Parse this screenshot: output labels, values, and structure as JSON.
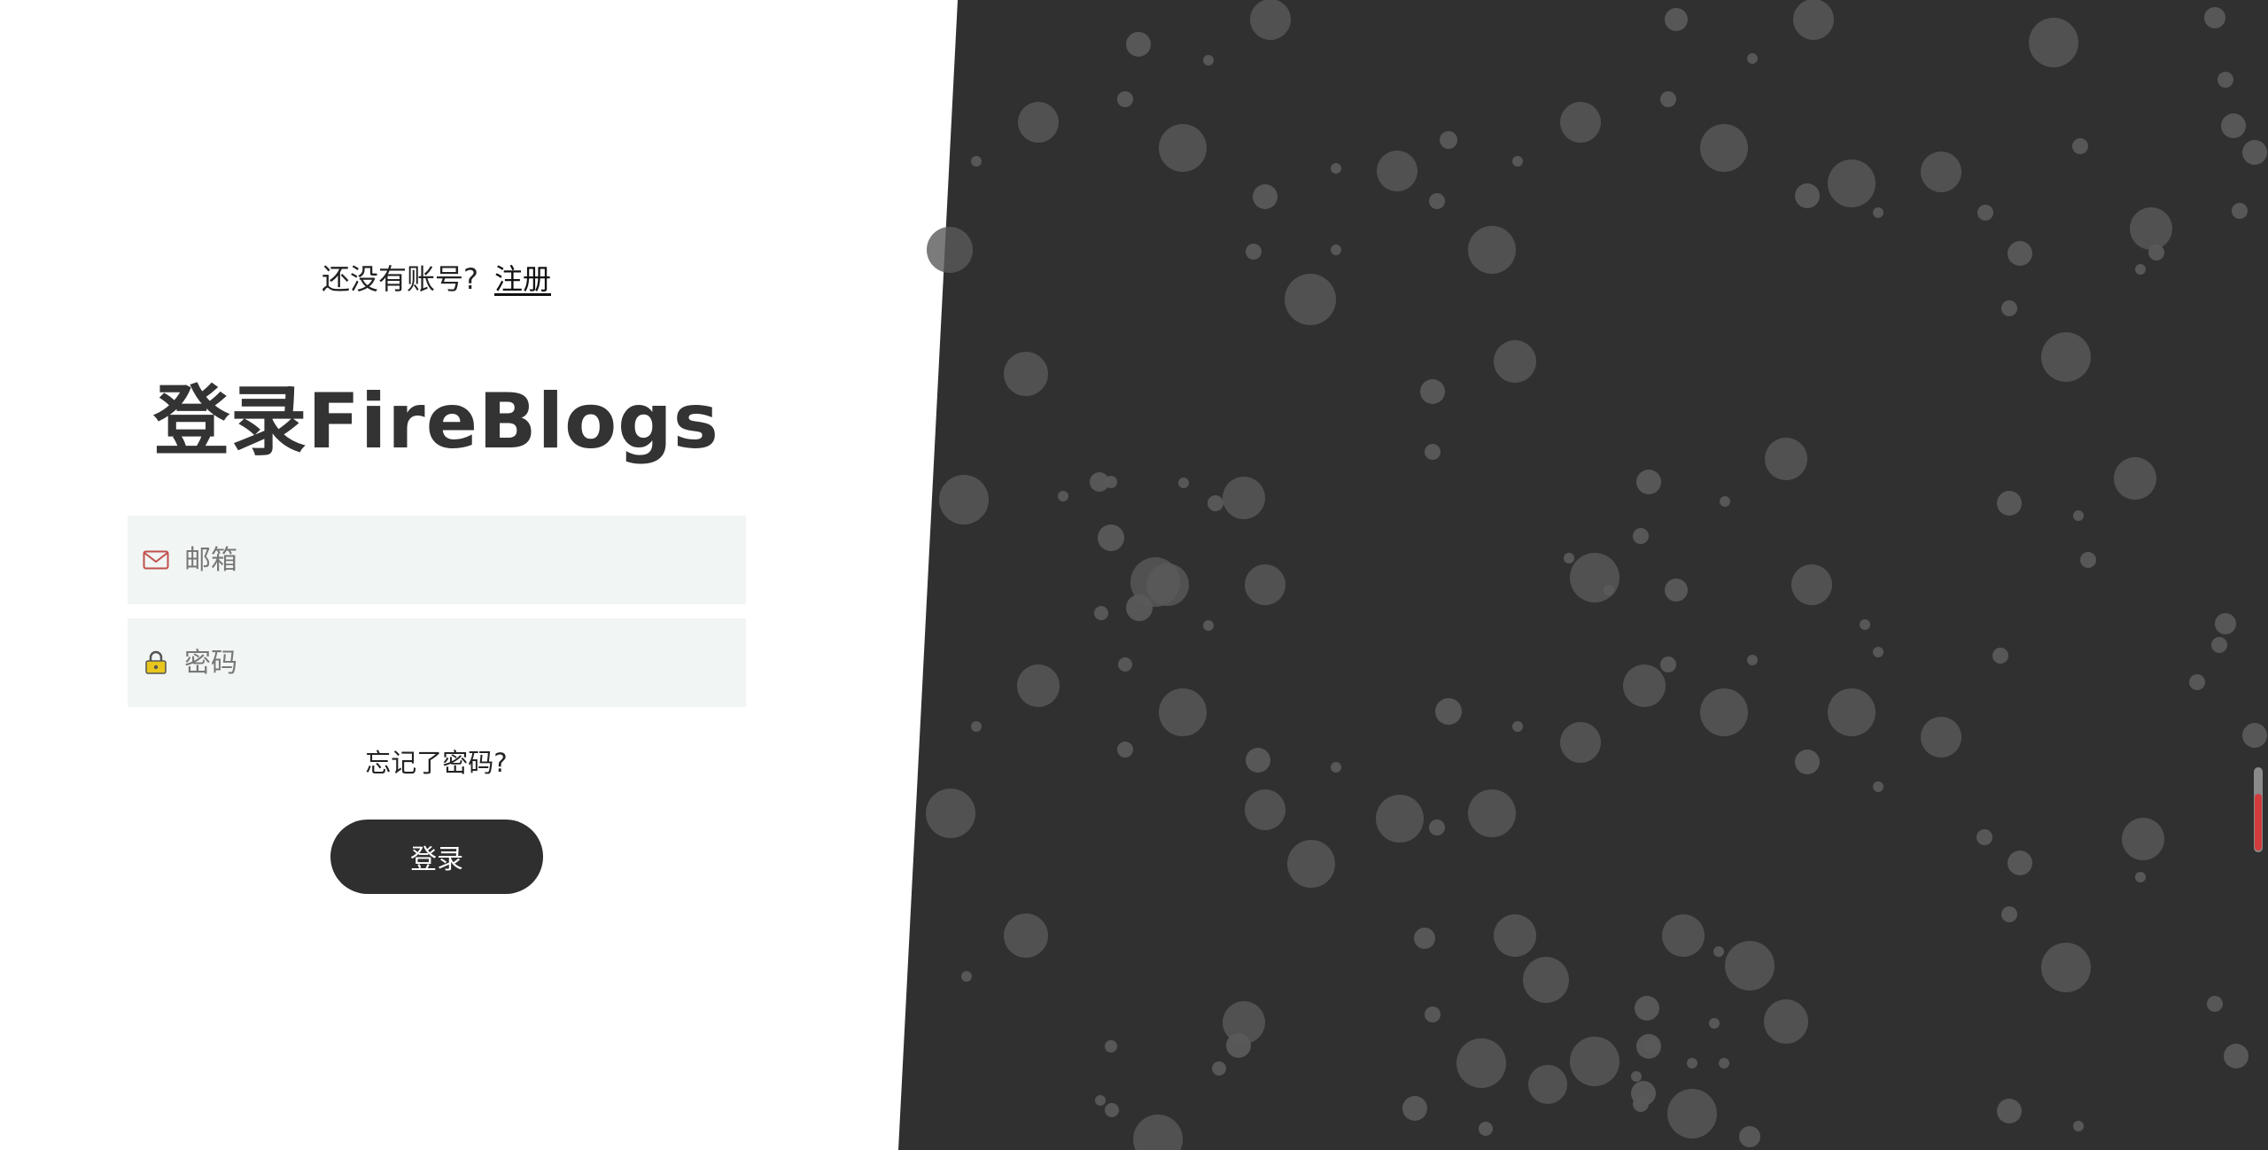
{
  "signup": {
    "question": "还没有账号?",
    "link": "注册"
  },
  "login": {
    "title": "登录FireBlogs",
    "email_placeholder": "邮箱",
    "password_placeholder": "密码",
    "forgot_password": "忘记了密码?",
    "submit_label": "登录"
  },
  "icons": {
    "email": "envelope-icon",
    "password": "lock-icon"
  },
  "colors": {
    "dark_panel": "#303030",
    "bubble": "#5a5a5a",
    "button": "#2f2f2f",
    "input_bg": "#f1f5f4",
    "envelope": "#c0504d",
    "lock": "#e8c61e"
  },
  "scroll_indicator": {
    "fill_fraction": 0.7
  }
}
